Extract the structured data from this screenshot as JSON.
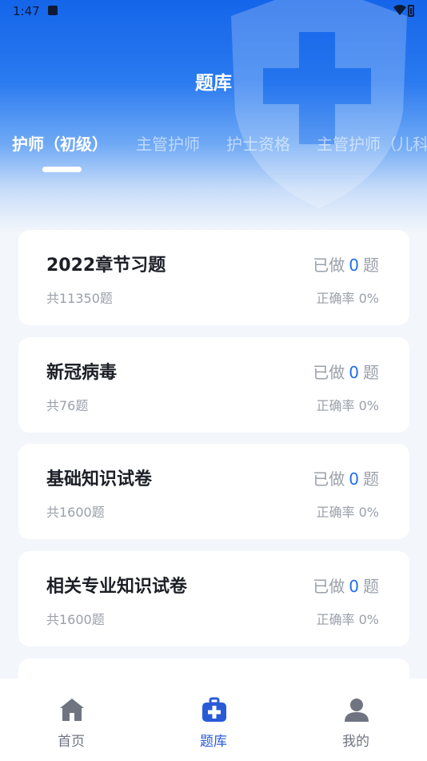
{
  "status_bar": {
    "time": "1:47"
  },
  "header": {
    "title": "题库"
  },
  "tabs": [
    {
      "label": "护师（初级）",
      "active": true
    },
    {
      "label": "主管护师",
      "active": false
    },
    {
      "label": "护士资格",
      "active": false
    },
    {
      "label": "主管护师（儿科",
      "active": false
    }
  ],
  "cards": [
    {
      "title": "2022章节习题",
      "total": "共11350题",
      "done_prefix": "已做",
      "done_count": "0",
      "done_suffix": "题",
      "accuracy": "正确率 0%"
    },
    {
      "title": "新冠病毒",
      "total": "共76题",
      "done_prefix": "已做",
      "done_count": "0",
      "done_suffix": "题",
      "accuracy": "正确率 0%"
    },
    {
      "title": "基础知识试卷",
      "total": "共1600题",
      "done_prefix": "已做",
      "done_count": "0",
      "done_suffix": "题",
      "accuracy": "正确率 0%"
    },
    {
      "title": "相关专业知识试卷",
      "total": "共1600题",
      "done_prefix": "已做",
      "done_count": "0",
      "done_suffix": "题",
      "accuracy": "正确率 0%"
    }
  ],
  "bottom_nav": [
    {
      "label": "首页",
      "icon": "home-icon",
      "active": false
    },
    {
      "label": "题库",
      "icon": "medical-kit-icon",
      "active": true
    },
    {
      "label": "我的",
      "icon": "user-icon",
      "active": false
    }
  ],
  "colors": {
    "accent": "#1f6ef0",
    "nav_active": "#2a5bd7",
    "header_blue": "#1565ea"
  }
}
